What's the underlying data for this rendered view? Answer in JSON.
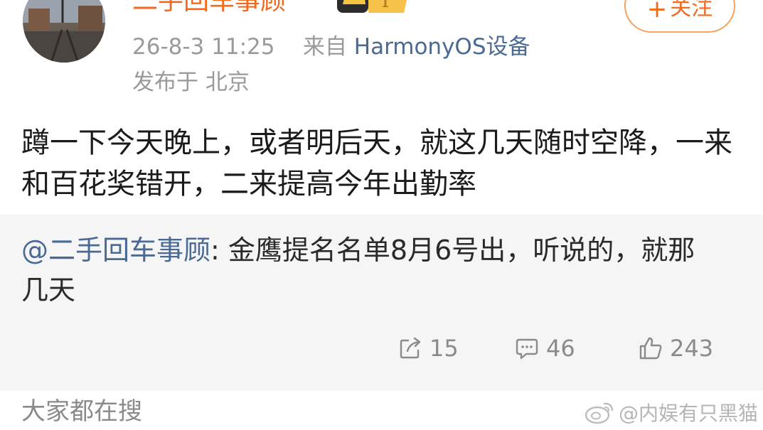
{
  "header": {
    "username": "二手回车事顾",
    "badge_text": "T",
    "follow_label": "关注",
    "follow_plus": "+",
    "timestamp": "26-8-3 11:25",
    "source_prefix": "来自",
    "source_device": "HarmonyOS设备",
    "location": "发布于 北京"
  },
  "post": {
    "text": "蹲一下今天晚上，或者明后天，就这几天随时空降，一来和百花奖错开，二来提高今年出勤率"
  },
  "quote": {
    "mention": "@二手回车事顾",
    "text": ": 金鹰提名名单8月6号出，听说的，就那几天",
    "repost_count": "15",
    "comment_count": "46",
    "like_count": "243"
  },
  "footer": {
    "label": "大家都在搜",
    "watermark": "@内娱有只黑猫"
  },
  "colors": {
    "username": "#f36a1f",
    "link": "#4a6a94",
    "quote_background": "#f5f5f5",
    "meta_text": "#9a9a9a"
  },
  "icons": {
    "repost": "repost-icon",
    "comment": "comment-icon",
    "like": "thumbs-up-icon",
    "watermark": "weibo-logo-icon"
  }
}
